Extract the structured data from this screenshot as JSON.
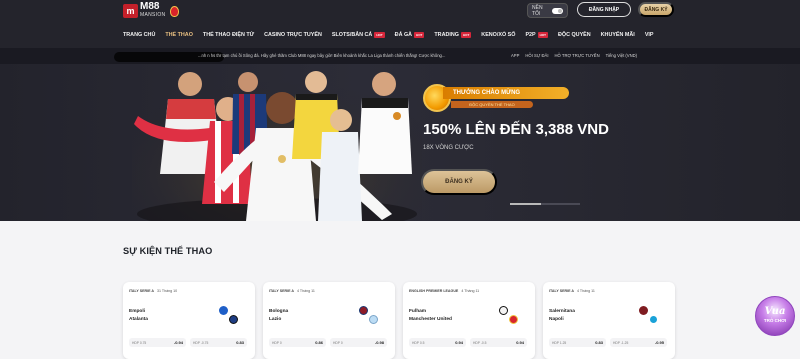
{
  "header": {
    "logo": {
      "brand": "M88",
      "subtitle": "MANSION"
    },
    "theme_toggle": {
      "label": "NỀN TỐI"
    },
    "login_label": "ĐĂNG NHẬP",
    "register_label": "ĐĂNG KÝ"
  },
  "nav": {
    "items": [
      {
        "label": "TRANG CHỦ",
        "hot": false
      },
      {
        "label": "THỂ THAO",
        "hot": false,
        "active": true
      },
      {
        "label": "THỂ THAO ĐIỆN TỬ",
        "hot": false
      },
      {
        "label": "CASINO TRỰC TUYẾN",
        "hot": false
      },
      {
        "label": "SLOTS/BẮN CÁ",
        "hot": true
      },
      {
        "label": "ĐÁ GÀ",
        "hot": true
      },
      {
        "label": "TRADING",
        "hot": true
      },
      {
        "label": "KENO/XỔ SỐ",
        "hot": false
      },
      {
        "label": "P2P",
        "hot": true
      },
      {
        "label": "ĐỘC QUYỀN",
        "hot": false
      },
      {
        "label": "KHUYẾN MÃI",
        "hot": false
      },
      {
        "label": "VIP",
        "hot": false
      }
    ],
    "hot_label": "HOT"
  },
  "ticker": {
    "text": "...nh n hs thr tạm chú ồi Sông đá. Hãy ghé thăm Club M88 ngay bây giờ!     Biên khoảnh khắc La Liga thành chiến thắng! Cược không...",
    "links": [
      "APP",
      "HỖI SỰ ĐÃI",
      "HỖ TRỢ TRỰC TUYẾN",
      "Tiếng Việt (VND)"
    ]
  },
  "hero": {
    "badge_title": "THƯỞNG CHÀO MỪNG",
    "badge_subtitle": "ĐỘC QUYỀN THỂ THAO",
    "headline": "150% LÊN ĐẾN 3,388 VND",
    "sub": "18X VÒNG CƯỢC",
    "cta_label": "ĐĂNG KÝ"
  },
  "section": {
    "title": "SỰ KIỆN THỂ THAO"
  },
  "matches": [
    {
      "league": "ITALY SERIE A",
      "date": "31 Tháng 10",
      "team1": "Empoli",
      "team2": "Atalanta",
      "odds": [
        {
          "label": "HDP 0.75",
          "value": "-0.94"
        },
        {
          "label": "HDP -0.75",
          "value": "0.83"
        }
      ]
    },
    {
      "league": "ITALY SERIE A",
      "date": "4 Tháng 11",
      "team1": "Bologna",
      "team2": "Lazio",
      "odds": [
        {
          "label": "HDP 0",
          "value": "0.86"
        },
        {
          "label": "HDP 0",
          "value": "-0.98"
        }
      ]
    },
    {
      "league": "ENGLISH PREMIER LEAGUE",
      "date": "4 Tháng 11",
      "team1": "Fulham",
      "team2": "Manchester United",
      "odds": [
        {
          "label": "HDP 0.5",
          "value": "0.94"
        },
        {
          "label": "HDP -0.5",
          "value": "0.94"
        }
      ]
    },
    {
      "league": "ITALY SERIE A",
      "date": "4 Tháng 11",
      "team1": "Salernitana",
      "team2": "Napoli",
      "odds": [
        {
          "label": "HDP 1.25",
          "value": "0.83"
        },
        {
          "label": "HDP -1.25",
          "value": "-0.95"
        }
      ]
    }
  ],
  "game_badge": {
    "title": "Vua",
    "subtitle": "TRÒ CHƠI"
  },
  "colors": {
    "header_bg": "#24242c",
    "accent_gold": "#c9a66b",
    "hot_red": "#d6263a",
    "active_nav": "#e9c082"
  }
}
